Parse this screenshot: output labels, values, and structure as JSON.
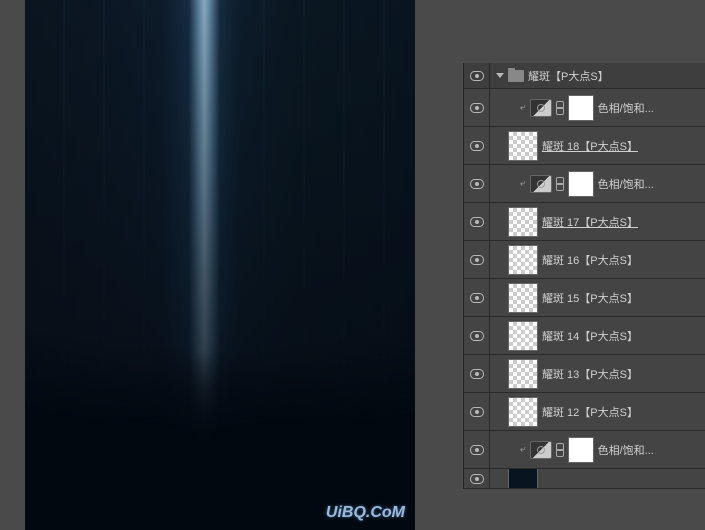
{
  "canvas": {
    "watermark": "UiBQ.CoM"
  },
  "layers_panel": {
    "group": {
      "name": "耀斑【P大点S】",
      "expanded": true
    },
    "rows": [
      {
        "type": "adjustment",
        "name": "色相/饱和...",
        "clipped": true
      },
      {
        "type": "image",
        "name": "耀斑 18【P大点S】",
        "underlined": true
      },
      {
        "type": "adjustment",
        "name": "色相/饱和...",
        "clipped": true
      },
      {
        "type": "image",
        "name": "耀斑 17【P大点S】",
        "underlined": true
      },
      {
        "type": "image",
        "name": "耀斑 16【P大点S】"
      },
      {
        "type": "image",
        "name": "耀斑 15【P大点S】"
      },
      {
        "type": "image",
        "name": "耀斑 14【P大点S】"
      },
      {
        "type": "image",
        "name": "耀斑 13【P大点S】"
      },
      {
        "type": "image",
        "name": "耀斑 12【P大点S】"
      },
      {
        "type": "adjustment",
        "name": "色相/饱和...",
        "clipped": true
      },
      {
        "type": "image_dark",
        "name": "",
        "partial": true
      }
    ]
  }
}
